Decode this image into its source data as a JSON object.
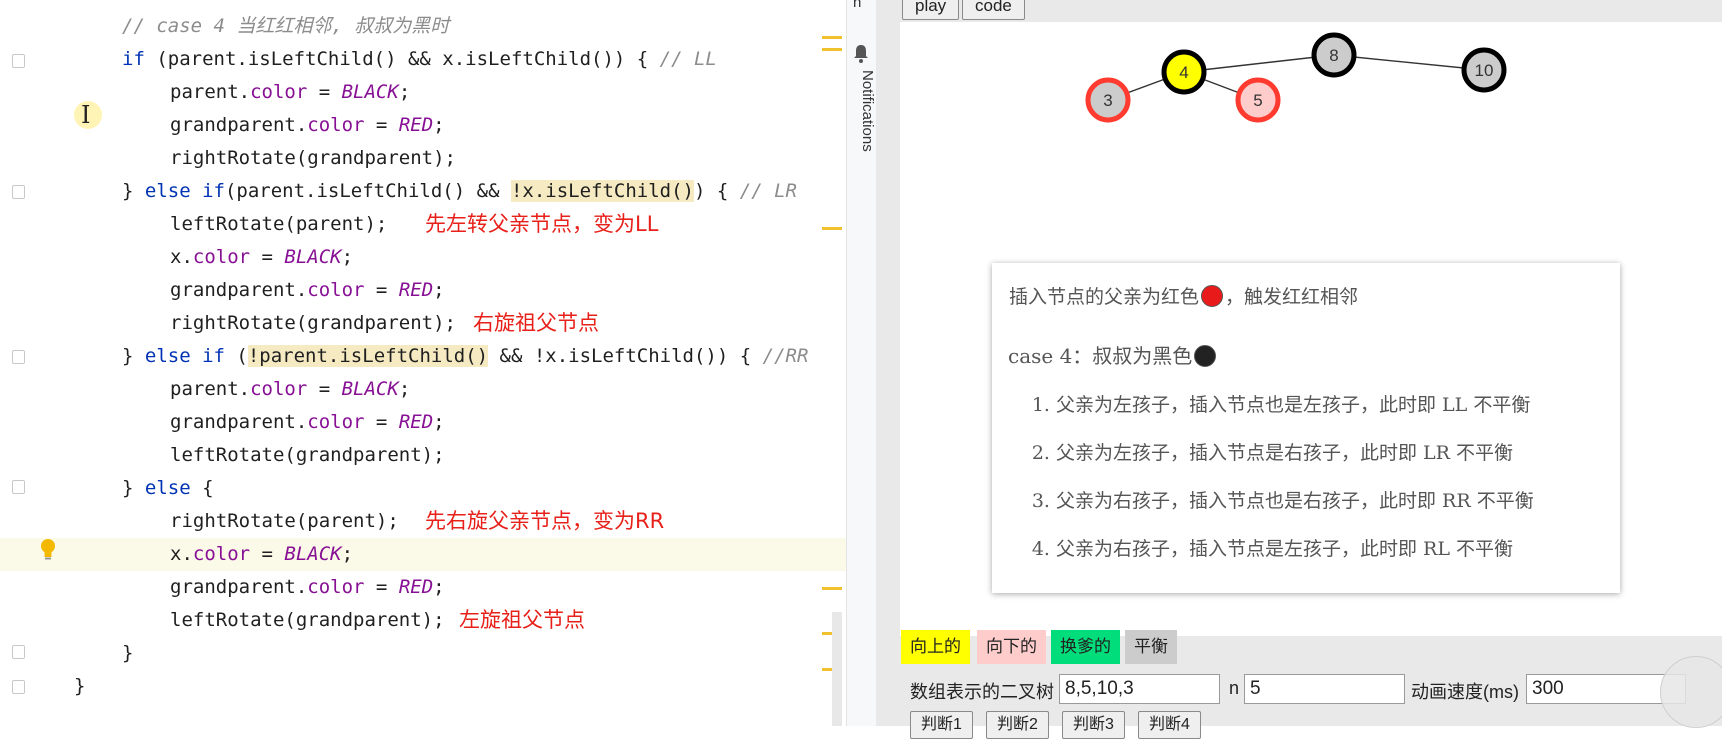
{
  "editor": {
    "lines": [
      {
        "indent": 0,
        "tokens": [
          {
            "c": "cmt",
            "t": "// case 4 当红红相邻, 叔叔为黑时"
          }
        ]
      },
      {
        "indent": 0,
        "tokens": [
          {
            "c": "kw",
            "t": "if"
          },
          {
            "c": "",
            "t": " (parent.isLeftChild() && x.isLeftChild()) { "
          },
          {
            "c": "cmt",
            "t": "// LL"
          }
        ]
      },
      {
        "indent": 1,
        "tokens": [
          {
            "c": "",
            "t": "parent."
          },
          {
            "c": "fld",
            "t": "color"
          },
          {
            "c": "",
            "t": " = "
          },
          {
            "c": "cst",
            "t": "BLACK"
          },
          {
            "c": "",
            "t": ";"
          }
        ]
      },
      {
        "indent": 1,
        "tokens": [
          {
            "c": "",
            "t": "grandparent."
          },
          {
            "c": "fld",
            "t": "color"
          },
          {
            "c": "",
            "t": " = "
          },
          {
            "c": "cst",
            "t": "RED"
          },
          {
            "c": "",
            "t": ";"
          }
        ]
      },
      {
        "indent": 1,
        "tokens": [
          {
            "c": "",
            "t": "rightRotate(grandparent);"
          }
        ]
      },
      {
        "indent": 0,
        "tokens": [
          {
            "c": "",
            "t": "} "
          },
          {
            "c": "kw",
            "t": "else if"
          },
          {
            "c": "",
            "t": "(parent.isLeftChild() && "
          },
          {
            "c": "hl",
            "t": "!x.isLeftChild()"
          },
          {
            "c": "",
            "t": ") { "
          },
          {
            "c": "cmt",
            "t": "// LR"
          }
        ]
      },
      {
        "indent": 1,
        "tokens": [
          {
            "c": "",
            "t": "leftRotate(parent);"
          }
        ],
        "note": "先左转父亲节点，变为LL"
      },
      {
        "indent": 1,
        "tokens": [
          {
            "c": "",
            "t": "x."
          },
          {
            "c": "fld",
            "t": "color"
          },
          {
            "c": "",
            "t": " = "
          },
          {
            "c": "cst",
            "t": "BLACK"
          },
          {
            "c": "",
            "t": ";"
          }
        ]
      },
      {
        "indent": 1,
        "tokens": [
          {
            "c": "",
            "t": "grandparent."
          },
          {
            "c": "fld",
            "t": "color"
          },
          {
            "c": "",
            "t": " = "
          },
          {
            "c": "cst",
            "t": "RED"
          },
          {
            "c": "",
            "t": ";"
          }
        ]
      },
      {
        "indent": 1,
        "tokens": [
          {
            "c": "",
            "t": "rightRotate(grandparent);"
          }
        ],
        "note": "右旋祖父节点"
      },
      {
        "indent": 0,
        "tokens": [
          {
            "c": "",
            "t": "} "
          },
          {
            "c": "kw",
            "t": "else if"
          },
          {
            "c": "",
            "t": " ("
          },
          {
            "c": "hl",
            "t": "!parent.isLeftChild()"
          },
          {
            "c": "",
            "t": " && !x.isLeftChild()) { "
          },
          {
            "c": "cmt",
            "t": "//RR"
          }
        ]
      },
      {
        "indent": 1,
        "tokens": [
          {
            "c": "",
            "t": "parent."
          },
          {
            "c": "fld",
            "t": "color"
          },
          {
            "c": "",
            "t": " = "
          },
          {
            "c": "cst",
            "t": "BLACK"
          },
          {
            "c": "",
            "t": ";"
          }
        ]
      },
      {
        "indent": 1,
        "tokens": [
          {
            "c": "",
            "t": "grandparent."
          },
          {
            "c": "fld",
            "t": "color"
          },
          {
            "c": "",
            "t": " = "
          },
          {
            "c": "cst",
            "t": "RED"
          },
          {
            "c": "",
            "t": ";"
          }
        ]
      },
      {
        "indent": 1,
        "tokens": [
          {
            "c": "",
            "t": "leftRotate(grandparent);"
          }
        ]
      },
      {
        "indent": 0,
        "tokens": [
          {
            "c": "",
            "t": "} "
          },
          {
            "c": "kw",
            "t": "else"
          },
          {
            "c": "",
            "t": " {"
          }
        ]
      },
      {
        "indent": 1,
        "tokens": [
          {
            "c": "",
            "t": "rightRotate(parent);"
          }
        ],
        "note": "先右旋父亲节点，变为RR"
      },
      {
        "indent": 1,
        "tokens": [
          {
            "c": "",
            "t": "x."
          },
          {
            "c": "fld",
            "t": "color"
          },
          {
            "c": "",
            "t": " = "
          },
          {
            "c": "cst",
            "t": "BLACK"
          },
          {
            "c": "",
            "t": ";"
          }
        ],
        "current": true
      },
      {
        "indent": 1,
        "tokens": [
          {
            "c": "",
            "t": "grandparent."
          },
          {
            "c": "fld",
            "t": "color"
          },
          {
            "c": "",
            "t": " = "
          },
          {
            "c": "cst",
            "t": "RED"
          },
          {
            "c": "",
            "t": ";"
          }
        ]
      },
      {
        "indent": 1,
        "tokens": [
          {
            "c": "",
            "t": "leftRotate(grandparent);"
          }
        ],
        "note": "左旋祖父节点"
      },
      {
        "indent": 0,
        "tokens": [
          {
            "c": "",
            "t": "}"
          }
        ]
      },
      {
        "indent": -1,
        "tokens": [
          {
            "c": "",
            "t": "}"
          }
        ]
      }
    ]
  },
  "side_strip": {
    "top_text": "n",
    "notifications_label": "Notifications"
  },
  "viz": {
    "buttons": {
      "play": "play",
      "code": "code"
    },
    "tree": {
      "nodes": [
        {
          "id": "3",
          "label": "3",
          "fill": "#cccccc",
          "stroke": "#ff3b2f"
        },
        {
          "id": "4",
          "label": "4",
          "fill": "#ffff00",
          "stroke": "#000000"
        },
        {
          "id": "5",
          "label": "5",
          "fill": "#ffcccc",
          "stroke": "#ff3b2f"
        },
        {
          "id": "8",
          "label": "8",
          "fill": "#cccccc",
          "stroke": "#000000"
        },
        {
          "id": "10",
          "label": "10",
          "fill": "#cccccc",
          "stroke": "#000000"
        }
      ],
      "edges": [
        [
          "4",
          "3"
        ],
        [
          "4",
          "5"
        ],
        [
          "8",
          "4"
        ],
        [
          "8",
          "10"
        ]
      ]
    },
    "panel": {
      "line1_a": "插入节点的父亲为红色",
      "line1_b": "，触发红红相邻",
      "line2": "case 4：叔叔为黑色",
      "items": [
        "父亲为左孩子，插入节点也是左孩子，此时即 LL 不平衡",
        "父亲为左孩子，插入节点是右孩子，此时即 LR 不平衡",
        "父亲为右孩子，插入节点也是右孩子，此时即 RR 不平衡",
        "父亲为右孩子，插入节点是左孩子，此时即 RL 不平衡"
      ],
      "colors": {
        "red": "#e81a1a",
        "black": "#222222"
      }
    },
    "legend": [
      {
        "label": "向上的",
        "color": "#ffff00"
      },
      {
        "label": "向下的",
        "color": "#ffcccc"
      },
      {
        "label": "换爹的",
        "color": "#00dd7a"
      },
      {
        "label": "平衡",
        "color": "#cccccc"
      }
    ],
    "form": {
      "array_label": "数组表示的二叉树",
      "array_value": "8,5,10,3",
      "n_label": "n",
      "n_value": "5",
      "speed_label": "动画速度(ms)",
      "speed_value": "300"
    },
    "judge_buttons": [
      "判断1",
      "判断2",
      "判断3",
      "判断4"
    ]
  }
}
